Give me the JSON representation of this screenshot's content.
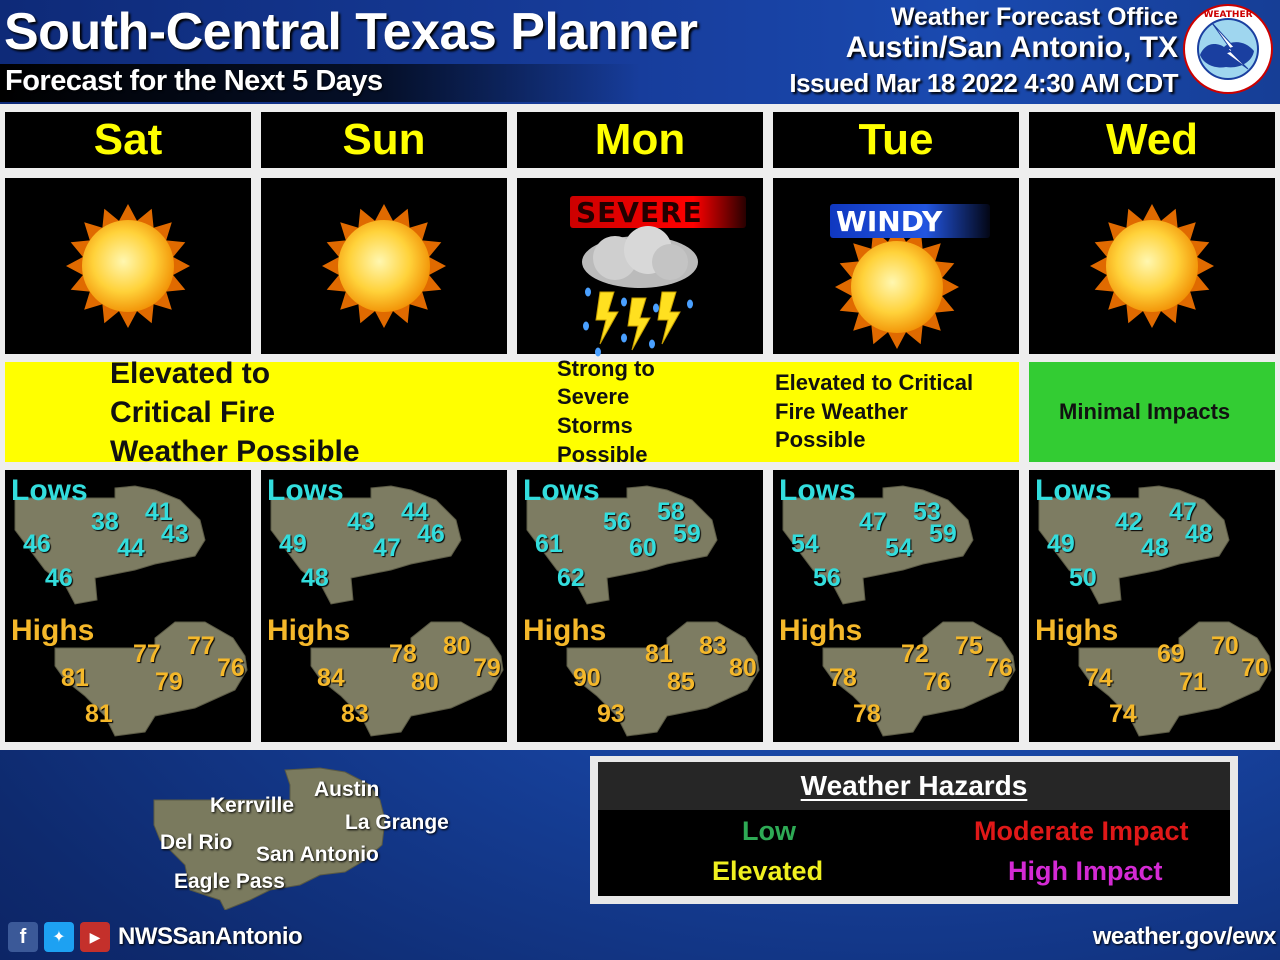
{
  "header": {
    "title": "South-Central Texas Planner",
    "subtitle": "Forecast for the Next 5 Days",
    "office_line1": "Weather Forecast Office",
    "office_line2": "Austin/San Antonio, TX",
    "issued": "Issued Mar 18 2022 4:30 AM CDT",
    "logo": "nws-logo"
  },
  "days": [
    {
      "name": "Sat",
      "icon": "sunny-icon",
      "tag": ""
    },
    {
      "name": "Sun",
      "icon": "sunny-icon",
      "tag": ""
    },
    {
      "name": "Mon",
      "icon": "severe-thunderstorm-icon",
      "tag": "SEVERE"
    },
    {
      "name": "Tue",
      "icon": "sunny-icon",
      "tag": "WINDY"
    },
    {
      "name": "Wed",
      "icon": "sunny-icon",
      "tag": ""
    }
  ],
  "hazards": [
    {
      "text": "Elevated to Critical Fire Weather Possible",
      "level": "Elevated",
      "color": "#ffff00",
      "days": [
        "Sat",
        "Sun"
      ]
    },
    {
      "text": "Strong to Severe Storms Possible",
      "level": "Elevated",
      "color": "#ffff00",
      "days": [
        "Mon"
      ]
    },
    {
      "text": "Elevated to Critical Fire Weather Possible",
      "level": "Elevated",
      "color": "#ffff00",
      "days": [
        "Tue"
      ]
    },
    {
      "text": "Minimal Impacts",
      "level": "Low",
      "color": "#33cc33",
      "days": [
        "Wed"
      ]
    }
  ],
  "temps_labels": {
    "lows": "Lows",
    "highs": "Highs"
  },
  "temps": [
    {
      "day": "Sat",
      "lows": [
        "38",
        "41",
        "46",
        "44",
        "43",
        "46"
      ],
      "highs": [
        "77",
        "77",
        "81",
        "79",
        "76",
        "81"
      ]
    },
    {
      "day": "Sun",
      "lows": [
        "43",
        "44",
        "49",
        "47",
        "46",
        "48"
      ],
      "highs": [
        "78",
        "80",
        "84",
        "80",
        "79",
        "83"
      ]
    },
    {
      "day": "Mon",
      "lows": [
        "56",
        "58",
        "61",
        "60",
        "59",
        "62"
      ],
      "highs": [
        "81",
        "83",
        "90",
        "85",
        "80",
        "93"
      ]
    },
    {
      "day": "Tue",
      "lows": [
        "47",
        "53",
        "54",
        "54",
        "59",
        "56"
      ],
      "highs": [
        "72",
        "75",
        "78",
        "76",
        "76",
        "78"
      ]
    },
    {
      "day": "Wed",
      "lows": [
        "42",
        "47",
        "49",
        "48",
        "48",
        "50"
      ],
      "highs": [
        "69",
        "70",
        "74",
        "71",
        "70",
        "74"
      ]
    }
  ],
  "cities": [
    "Austin",
    "Kerrville",
    "La Grange",
    "Del Rio",
    "San Antonio",
    "Eagle Pass"
  ],
  "legend": {
    "title": "Weather Hazards",
    "items": [
      {
        "label": "Low",
        "color": "#2eaa55"
      },
      {
        "label": "Moderate Impact",
        "color": "#e01818"
      },
      {
        "label": "Elevated",
        "color": "#f0f020"
      },
      {
        "label": "High Impact",
        "color": "#d42ad4"
      }
    ]
  },
  "footer": {
    "social": [
      "facebook-icon",
      "twitter-icon",
      "youtube-icon"
    ],
    "handle": "NWSSanAntonio",
    "website": "weather.gov/ewx"
  },
  "colors": {
    "day_text": "#ffff00",
    "lows": "#33dddd",
    "highs": "#f5b82a",
    "elevated": "#ffff00",
    "minimal": "#33cc33",
    "background": "#16409a"
  }
}
